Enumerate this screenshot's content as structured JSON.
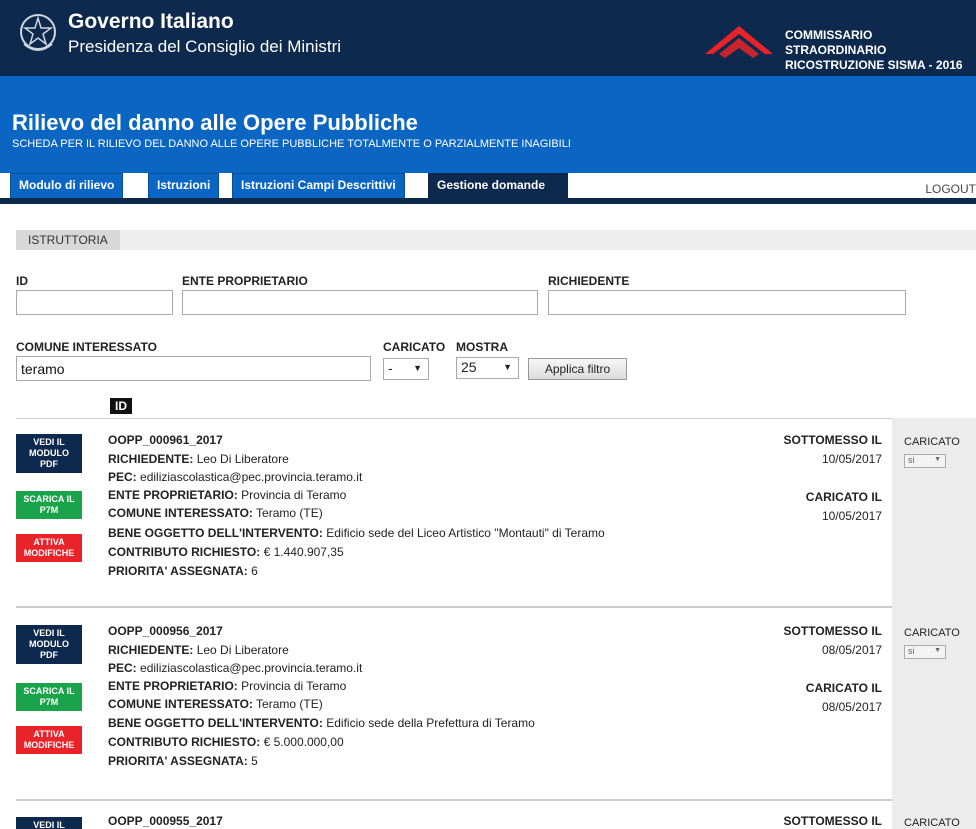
{
  "header": {
    "gov_title": "Governo Italiano",
    "gov_subtitle": "Presidenza del Consiglio dei Ministri",
    "commissario_line1": "COMMISSARIO STRAORDINARIO",
    "commissario_line2": "RICOSTRUZIONE SISMA - 2016"
  },
  "app": {
    "title": "Rilievo del danno alle Opere Pubbliche",
    "subtitle": "SCHEDA PER IL RILIEVO DEL DANNO ALLE OPERE PUBBLICHE TOTALMENTE O PARZIALMENTE INAGIBILI"
  },
  "nav": {
    "tabs": [
      {
        "label": "Modulo di rilievo"
      },
      {
        "label": "Istruzioni"
      },
      {
        "label": "Istruzioni Campi Descrittivi"
      },
      {
        "label": "Gestione domande"
      }
    ],
    "active_tab": "Gestione domande",
    "logout": "LOGOUT"
  },
  "section": {
    "label": "ISTRUTTORIA"
  },
  "filters": {
    "id_label": "ID",
    "id_value": "",
    "ente_label": "ENTE PROPRIETARIO",
    "ente_value": "",
    "richiedente_label": "RICHIEDENTE",
    "richiedente_value": "",
    "comune_label": "COMUNE INTERESSATO",
    "comune_value": "teramo",
    "caricato_label": "CARICATO",
    "caricato_value": "-",
    "mostra_label": "MOSTRA",
    "mostra_value": "25",
    "apply_button": "Applica filtro"
  },
  "list": {
    "id_header": "ID",
    "actions": {
      "pdf_1": "VEDI IL",
      "pdf_2": "MODULO",
      "pdf_3": "PDF",
      "p7m_1": "SCARICA IL",
      "p7m_2": "P7M",
      "mod_1": "ATTIVA",
      "mod_2": "MODIFICHE"
    },
    "labels": {
      "richiedente": "RICHIEDENTE:",
      "pec": "PEC:",
      "ente": "ENTE PROPRIETARIO:",
      "comune": "COMUNE INTERESSATO:",
      "bene": "BENE OGGETTO DELL'INTERVENTO:",
      "contributo": "CONTRIBUTO RICHIESTO:",
      "priorita": "PRIORITA' ASSEGNATA:",
      "sottomesso": "SOTTOMESSO IL",
      "caricato_il": "CARICATO IL",
      "caricato": "CARICATO"
    },
    "records": [
      {
        "id": "OOPP_000961_2017",
        "richiedente": "Leo Di Liberatore",
        "pec": "ediliziascolastica@pec.provincia.teramo.it",
        "ente": "Provincia di Teramo",
        "comune": "Teramo (TE)",
        "bene": "Edificio sede del Liceo Artistico \"Montauti\" di Teramo",
        "contributo": "€ 1.440.907,35",
        "priorita": "6",
        "sottomesso": "10/05/2017",
        "caricato_il": "10/05/2017",
        "caricato_value": "si"
      },
      {
        "id": "OOPP_000956_2017",
        "richiedente": "Leo Di Liberatore",
        "pec": "ediliziascolastica@pec.provincia.teramo.it",
        "ente": "Provincia di Teramo",
        "comune": "Teramo (TE)",
        "bene": "Edificio sede della Prefettura di Teramo",
        "contributo": "€ 5.000.000,00",
        "priorita": "5",
        "sottomesso": "08/05/2017",
        "caricato_il": "08/05/2017",
        "caricato_value": "si"
      },
      {
        "id": "OOPP_000955_2017"
      }
    ]
  },
  "colors": {
    "dark_navy": "#0d2a4e",
    "blue": "#0a66c2",
    "green": "#1aa34a",
    "red": "#e8232a"
  }
}
